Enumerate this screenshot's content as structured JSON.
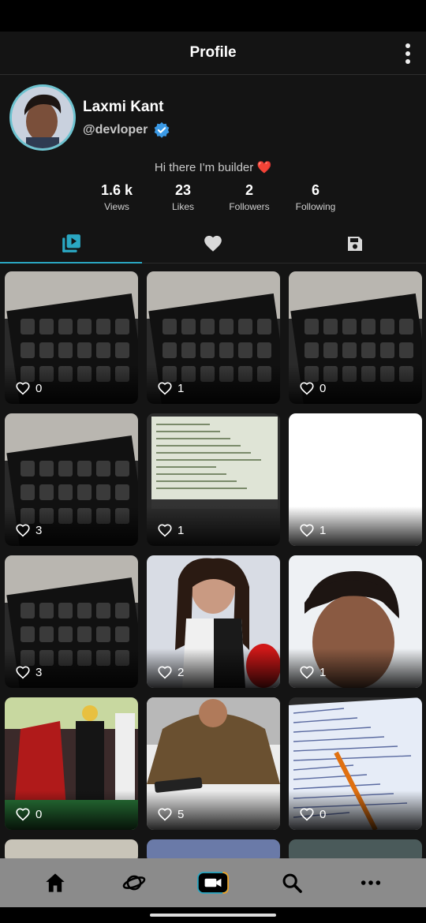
{
  "header": {
    "title": "Profile"
  },
  "profile": {
    "name": "Laxmi Kant",
    "handle": "@devloper",
    "bio": "Hi there I'm builder ❤️",
    "stats": [
      {
        "value": "1.6 k",
        "label": "Views"
      },
      {
        "value": "23",
        "label": "Likes"
      },
      {
        "value": "2",
        "label": "Followers"
      },
      {
        "value": "6",
        "label": "Following"
      }
    ]
  },
  "tabs": [
    {
      "name": "videos",
      "icon": "video-library-icon",
      "active": true
    },
    {
      "name": "liked",
      "icon": "heart-icon",
      "active": false
    },
    {
      "name": "saved",
      "icon": "save-icon",
      "active": false
    }
  ],
  "videos": [
    {
      "likes": "0",
      "thumb": "keyboard"
    },
    {
      "likes": "1",
      "thumb": "keyboard"
    },
    {
      "likes": "0",
      "thumb": "keyboard"
    },
    {
      "likes": "3",
      "thumb": "keyboard"
    },
    {
      "likes": "1",
      "thumb": "laptop-screen"
    },
    {
      "likes": "1",
      "thumb": "blank"
    },
    {
      "likes": "3",
      "thumb": "keyboard"
    },
    {
      "likes": "2",
      "thumb": "person"
    },
    {
      "likes": "1",
      "thumb": "selfie"
    },
    {
      "likes": "0",
      "thumb": "wedding"
    },
    {
      "likes": "5",
      "thumb": "office"
    },
    {
      "likes": "0",
      "thumb": "notebook"
    }
  ],
  "bottom_nav": [
    {
      "icon": "home-icon"
    },
    {
      "icon": "planet-icon"
    },
    {
      "icon": "video-camera-icon"
    },
    {
      "icon": "search-icon"
    },
    {
      "icon": "more-horizontal-icon"
    }
  ],
  "colors": {
    "accent": "#2aa7c2",
    "verified": "#3b9ae6",
    "background": "#141414"
  }
}
